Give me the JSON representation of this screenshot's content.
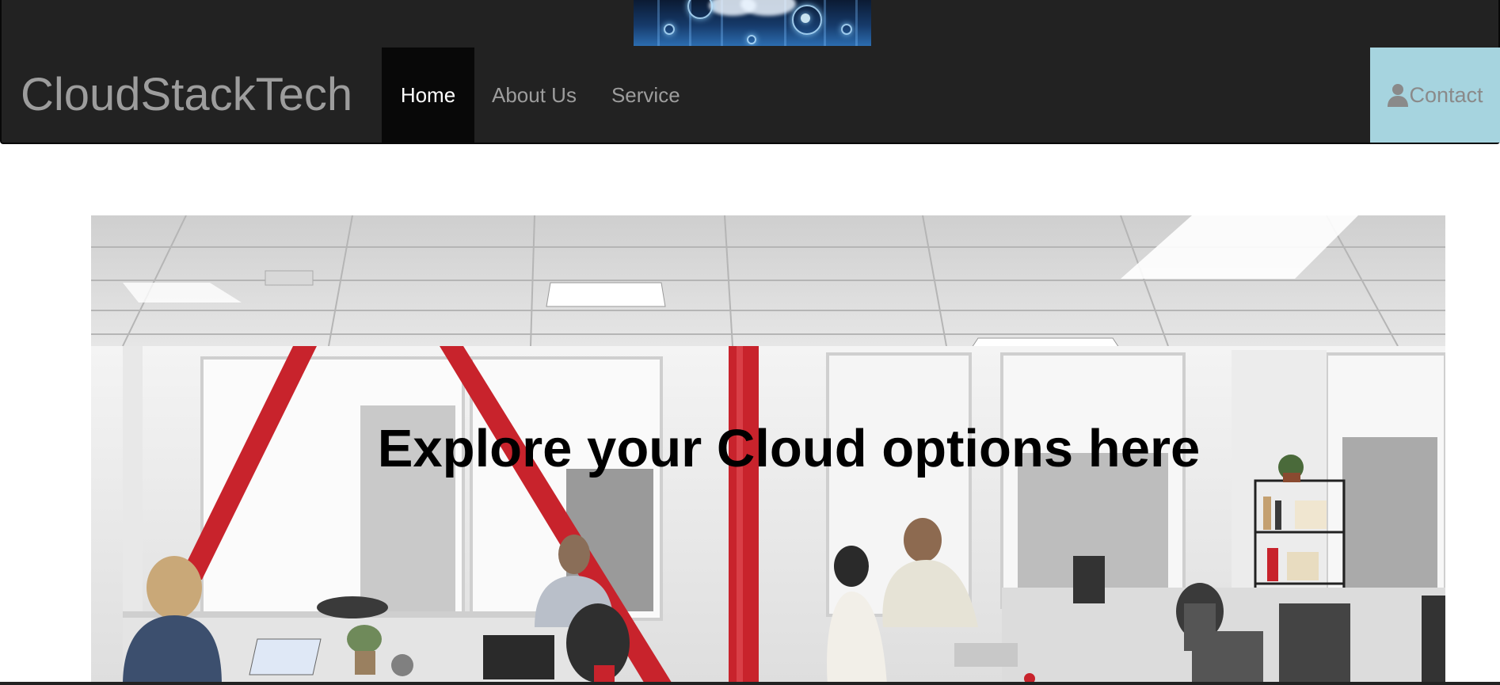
{
  "navbar": {
    "brand": "CloudStackTech",
    "items": [
      {
        "label": "Home",
        "active": true
      },
      {
        "label": "About Us",
        "active": false
      },
      {
        "label": "Service",
        "active": false
      }
    ],
    "contact_label": "Contact",
    "contact_icon": "user-icon"
  },
  "hero": {
    "title": "Explore your Cloud options here"
  },
  "colors": {
    "navbar_bg": "#222222",
    "nav_active_bg": "#080808",
    "nav_text": "#9d9d9d",
    "contact_bg": "#a6d4df",
    "accent_red": "#c8232c"
  }
}
